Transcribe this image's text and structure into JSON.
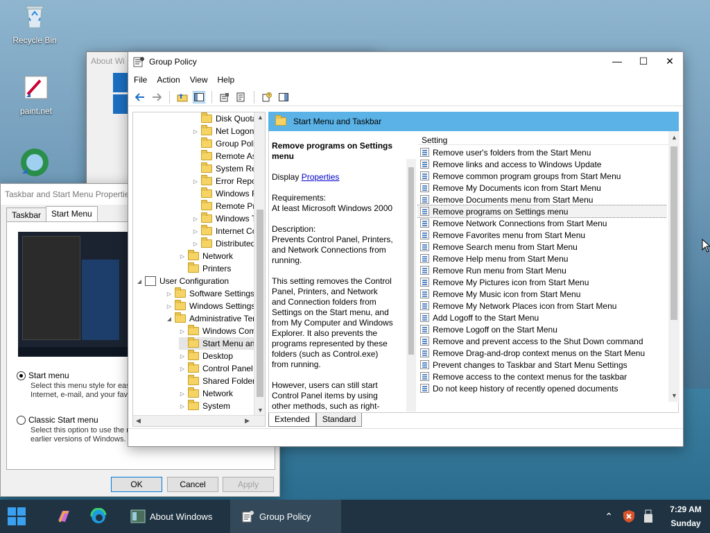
{
  "desktop": {
    "icons": [
      {
        "label": "Recycle Bin"
      },
      {
        "label": "paint.net"
      }
    ]
  },
  "about_window": {
    "title": "About Wi"
  },
  "taskbar_props": {
    "title": "Taskbar and Start Menu Properties",
    "tabs": [
      "Taskbar",
      "Start Menu"
    ],
    "options": [
      {
        "label": "Start menu",
        "desc1": "Select this menu style for easy",
        "desc2": "Internet, e-mail, and your favor",
        "selected": true
      },
      {
        "label": "Classic Start menu",
        "desc1": "Select this option to use the m",
        "desc2": "earlier versions of Windows.",
        "selected": false
      }
    ],
    "buttons": {
      "ok": "OK",
      "cancel": "Cancel",
      "apply": "Apply"
    }
  },
  "gp": {
    "title": "Group Policy",
    "menu": [
      "File",
      "Action",
      "View",
      "Help"
    ],
    "tree": [
      {
        "label": "Disk Quotas",
        "indent": 3,
        "exp": ""
      },
      {
        "label": "Net Logon",
        "indent": 3,
        "exp": ">"
      },
      {
        "label": "Group Policy",
        "indent": 3,
        "exp": ""
      },
      {
        "label": "Remote Assistanc",
        "indent": 3,
        "exp": ""
      },
      {
        "label": "System Restore",
        "indent": 3,
        "exp": ""
      },
      {
        "label": "Error Reporting",
        "indent": 3,
        "exp": ">"
      },
      {
        "label": "Windows File Pro",
        "indent": 3,
        "exp": ""
      },
      {
        "label": "Remote Procedur",
        "indent": 3,
        "exp": ""
      },
      {
        "label": "Windows Time Se",
        "indent": 3,
        "exp": ">"
      },
      {
        "label": "Internet Commu",
        "indent": 3,
        "exp": ">"
      },
      {
        "label": "Distributed COM",
        "indent": 3,
        "exp": ">"
      },
      {
        "label": "Network",
        "indent": 2,
        "exp": ">"
      },
      {
        "label": "Printers",
        "indent": 2,
        "exp": ""
      },
      {
        "label": "User Configuration",
        "indent": 0,
        "exp": "v",
        "special": true
      },
      {
        "label": "Software Settings",
        "indent": 1,
        "exp": ">"
      },
      {
        "label": "Windows Settings",
        "indent": 1,
        "exp": ">"
      },
      {
        "label": "Administrative Template",
        "indent": 1,
        "exp": "v"
      },
      {
        "label": "Windows Componen",
        "indent": 2,
        "exp": ">"
      },
      {
        "label": "Start Menu and Taskb",
        "indent": 2,
        "exp": "",
        "selected": true
      },
      {
        "label": "Desktop",
        "indent": 2,
        "exp": ">"
      },
      {
        "label": "Control Panel",
        "indent": 2,
        "exp": ">"
      },
      {
        "label": "Shared Folders",
        "indent": 2,
        "exp": ""
      },
      {
        "label": "Network",
        "indent": 2,
        "exp": ">"
      },
      {
        "label": "System",
        "indent": 2,
        "exp": ">"
      }
    ],
    "header": "Start Menu and Taskbar",
    "description": {
      "heading": "Remove programs on Settings menu",
      "display_prefix": "Display ",
      "display_link": "Properties",
      "req_label": "Requirements:",
      "req_value": "At least Microsoft Windows 2000",
      "desc_label": "Description:",
      "desc_text": "Prevents Control Panel, Printers, and Network Connections from running.",
      "para2": "This setting removes the Control Panel, Printers, and Network and Connection folders from Settings on the Start menu, and from My Computer and Windows Explorer. It also prevents the programs represented by these folders (such as Control.exe) from running.",
      "para3": "However, users can still start Control Panel items by using other methods, such as right-clicking the desktop to start"
    },
    "list_header": "Setting",
    "settings": [
      "Remove user's folders from the Start Menu",
      "Remove links and access to Windows Update",
      "Remove common program groups from Start Menu",
      "Remove My Documents icon from Start Menu",
      "Remove Documents menu from Start Menu",
      "Remove programs on Settings menu",
      "Remove Network Connections from Start Menu",
      "Remove Favorites menu from Start Menu",
      "Remove Search menu from Start Menu",
      "Remove Help menu from Start Menu",
      "Remove Run menu from Start Menu",
      "Remove My Pictures icon from Start Menu",
      "Remove My Music icon from Start Menu",
      "Remove My Network Places icon from Start Menu",
      "Add Logoff to the Start Menu",
      "Remove Logoff on the Start Menu",
      "Remove and prevent access to the Shut Down command",
      "Remove Drag-and-drop context menus on the Start Menu",
      "Prevent changes to Taskbar and Start Menu Settings",
      "Remove access to the context menus for the taskbar",
      "Do not keep history of recently opened documents"
    ],
    "selected_setting": 5,
    "bottom_tabs": [
      "Extended",
      "Standard"
    ]
  },
  "taskbar": {
    "items": [
      "About Windows",
      "Group Policy"
    ],
    "time": "7:29 AM",
    "day": "Sunday"
  }
}
